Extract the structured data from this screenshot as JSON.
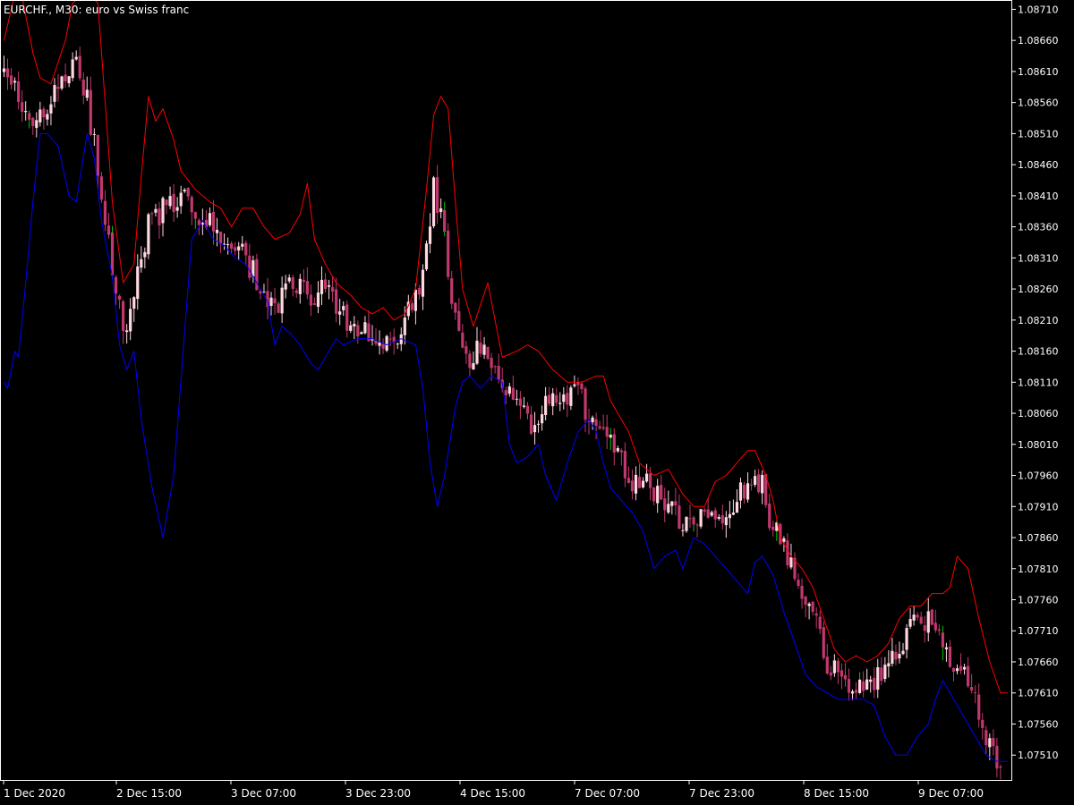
{
  "header": {
    "title": "EURCHF., M30:  euro vs Swiss franc"
  },
  "colors": {
    "background": "#000000",
    "frame": "#ffffff",
    "text": "#ffffff",
    "upper_band": "#ff0000",
    "lower_band": "#0000ff",
    "bear_candle": "#c2386e",
    "bull_candle": "#ffd8e0",
    "green_wick": "#00c800"
  },
  "chart_data": {
    "type": "candlestick",
    "title": "EURCHF., M30:  euro vs Swiss franc",
    "ylim": [
      1.0747,
      1.08725
    ],
    "y_ticks": [
      "1.08710",
      "1.08660",
      "1.08610",
      "1.08560",
      "1.08510",
      "1.08460",
      "1.08410",
      "1.08360",
      "1.08310",
      "1.08260",
      "1.08210",
      "1.08160",
      "1.08110",
      "1.08060",
      "1.08010",
      "1.07960",
      "1.07910",
      "1.07860",
      "1.07810",
      "1.07760",
      "1.07710",
      "1.07660",
      "1.07610",
      "1.07560",
      "1.07510"
    ],
    "x_ticks": [
      "1 Dec 2020",
      "2 Dec 15:00",
      "3 Dec 07:00",
      "3 Dec 23:00",
      "4 Dec 15:00",
      "7 Dec 07:00",
      "7 Dec 23:00",
      "8 Dec 15:00",
      "9 Dec 07:00"
    ],
    "close_anchors": [
      [
        0,
        1.0861
      ],
      [
        5,
        1.08555
      ],
      [
        10,
        1.0853
      ],
      [
        16,
        1.08595
      ],
      [
        20,
        1.0865
      ],
      [
        23,
        1.0856
      ],
      [
        27,
        1.0842
      ],
      [
        30,
        1.0828
      ],
      [
        34,
        1.0818
      ],
      [
        37,
        1.0829
      ],
      [
        40,
        1.0836
      ],
      [
        45,
        1.0839
      ],
      [
        50,
        1.084
      ],
      [
        54,
        1.0837
      ],
      [
        58,
        1.0836
      ],
      [
        62,
        1.0832
      ],
      [
        67,
        1.0831
      ],
      [
        72,
        1.0826
      ],
      [
        76,
        1.0823
      ],
      [
        80,
        1.0828
      ],
      [
        84,
        1.0824
      ],
      [
        88,
        1.0826
      ],
      [
        92,
        1.0823
      ],
      [
        96,
        1.082
      ],
      [
        100,
        1.0819
      ],
      [
        105,
        1.08185
      ],
      [
        110,
        1.08195
      ],
      [
        114,
        1.0824
      ],
      [
        117,
        1.0832
      ],
      [
        119,
        1.0842
      ],
      [
        121,
        1.0838
      ],
      [
        123,
        1.0828
      ],
      [
        126,
        1.0818
      ],
      [
        128,
        1.0814
      ],
      [
        132,
        1.0816
      ],
      [
        135,
        1.0813
      ],
      [
        138,
        1.0811
      ],
      [
        142,
        1.0808
      ],
      [
        146,
        1.0804
      ],
      [
        150,
        1.0809
      ],
      [
        154,
        1.08095
      ],
      [
        158,
        1.0809
      ],
      [
        161,
        1.0807
      ],
      [
        164,
        1.0806
      ],
      [
        167,
        1.0804
      ],
      [
        170,
        1.08
      ],
      [
        174,
        1.0794
      ],
      [
        178,
        1.0796
      ],
      [
        182,
        1.0792
      ],
      [
        186,
        1.0789
      ],
      [
        190,
        1.0787
      ],
      [
        194,
        1.0789
      ],
      [
        198,
        1.0788
      ],
      [
        201,
        1.079
      ],
      [
        204,
        1.0794
      ],
      [
        208,
        1.0796
      ],
      [
        210,
        1.0794
      ],
      [
        213,
        1.0787
      ],
      [
        216,
        1.0785
      ],
      [
        219,
        1.0779
      ],
      [
        222,
        1.0776
      ],
      [
        225,
        1.0772
      ],
      [
        228,
        1.0766
      ],
      [
        231,
        1.0764
      ],
      [
        234,
        1.0763
      ],
      [
        238,
        1.0762
      ],
      [
        242,
        1.0764
      ],
      [
        246,
        1.0767
      ],
      [
        250,
        1.077
      ],
      [
        254,
        1.0773
      ],
      [
        258,
        1.0772
      ],
      [
        261,
        1.0768
      ],
      [
        264,
        1.0766
      ],
      [
        267,
        1.0762
      ],
      [
        270,
        1.0758
      ],
      [
        273,
        1.0753
      ],
      [
        276,
        1.0749
      ]
    ],
    "series": [
      {
        "name": "",
        "color": "#ff0000",
        "points": [
          [
            0,
            1.0866
          ],
          [
            2,
            1.0871
          ],
          [
            4,
            1.0876
          ],
          [
            6,
            1.087
          ],
          [
            8,
            1.0864
          ],
          [
            10,
            1.086
          ],
          [
            13,
            1.0859
          ],
          [
            17,
            1.0866
          ],
          [
            19,
            1.0872
          ],
          [
            21,
            1.0873
          ],
          [
            23,
            1.0874
          ],
          [
            26,
            1.0872
          ],
          [
            28,
            1.0856
          ],
          [
            30,
            1.084
          ],
          [
            33,
            1.0827
          ],
          [
            36,
            1.083
          ],
          [
            38,
            1.0844
          ],
          [
            40,
            1.0857
          ],
          [
            42,
            1.0853
          ],
          [
            44,
            1.0855
          ],
          [
            47,
            1.085
          ],
          [
            49,
            1.0845
          ],
          [
            53,
            1.0842
          ],
          [
            57,
            1.084
          ],
          [
            60,
            1.0839
          ],
          [
            63,
            1.0836
          ],
          [
            66,
            1.0839
          ],
          [
            69,
            1.0839
          ],
          [
            72,
            1.0836
          ],
          [
            75,
            1.0834
          ],
          [
            79,
            1.0835
          ],
          [
            82,
            1.0838
          ],
          [
            84,
            1.0843
          ],
          [
            86,
            1.0834
          ],
          [
            89,
            1.083
          ],
          [
            92,
            1.0827
          ],
          [
            96,
            1.0825
          ],
          [
            99,
            1.0823
          ],
          [
            102,
            1.0822
          ],
          [
            105,
            1.0823
          ],
          [
            108,
            1.0821
          ],
          [
            111,
            1.0822
          ],
          [
            114,
            1.0826
          ],
          [
            117,
            1.0842
          ],
          [
            119,
            1.0854
          ],
          [
            121,
            1.0857
          ],
          [
            123,
            1.0855
          ],
          [
            125,
            1.084
          ],
          [
            127,
            1.0826
          ],
          [
            130,
            1.082
          ],
          [
            134,
            1.0827
          ],
          [
            136,
            1.0821
          ],
          [
            138,
            1.0815
          ],
          [
            142,
            1.0816
          ],
          [
            145,
            1.0817
          ],
          [
            148,
            1.0816
          ],
          [
            152,
            1.0813
          ],
          [
            156,
            1.0811
          ],
          [
            160,
            1.0811
          ],
          [
            164,
            1.0812
          ],
          [
            166,
            1.0812
          ],
          [
            168,
            1.0808
          ],
          [
            170,
            1.0806
          ],
          [
            173,
            1.0803
          ],
          [
            176,
            1.0798
          ],
          [
            180,
            1.0796
          ],
          [
            184,
            1.0797
          ],
          [
            188,
            1.0793
          ],
          [
            191,
            1.0791
          ],
          [
            194,
            1.0791
          ],
          [
            197,
            1.0795
          ],
          [
            200,
            1.0796
          ],
          [
            203,
            1.0798
          ],
          [
            206,
            1.08
          ],
          [
            208,
            1.08
          ],
          [
            211,
            1.0796
          ],
          [
            213,
            1.0792
          ],
          [
            215,
            1.0786
          ],
          [
            218,
            1.0783
          ],
          [
            221,
            1.0781
          ],
          [
            224,
            1.0778
          ],
          [
            227,
            1.0773
          ],
          [
            230,
            1.0768
          ],
          [
            233,
            1.0766
          ],
          [
            236,
            1.0767
          ],
          [
            239,
            1.0766
          ],
          [
            242,
            1.0767
          ],
          [
            245,
            1.0769
          ],
          [
            248,
            1.0773
          ],
          [
            251,
            1.0775
          ],
          [
            254,
            1.0775
          ],
          [
            257,
            1.0777
          ],
          [
            260,
            1.0777
          ],
          [
            262,
            1.0778
          ],
          [
            264,
            1.0783
          ],
          [
            267,
            1.0781
          ],
          [
            270,
            1.0773
          ],
          [
            273,
            1.0766
          ],
          [
            276,
            1.0761
          ],
          [
            278,
            1.0761
          ]
        ]
      },
      {
        "name": "",
        "color": "#0000ff",
        "points": [
          [
            0,
            1.0811
          ],
          [
            1,
            1.081
          ],
          [
            3,
            1.0816
          ],
          [
            4,
            1.0815
          ],
          [
            6,
            1.0827
          ],
          [
            8,
            1.084
          ],
          [
            10,
            1.0851
          ],
          [
            12,
            1.0851
          ],
          [
            15,
            1.0849
          ],
          [
            18,
            1.0841
          ],
          [
            20,
            1.084
          ],
          [
            23,
            1.0851
          ],
          [
            25,
            1.0847
          ],
          [
            27,
            1.0837
          ],
          [
            30,
            1.0828
          ],
          [
            32,
            1.0817
          ],
          [
            34,
            1.0813
          ],
          [
            36,
            1.0816
          ],
          [
            38,
            1.0805
          ],
          [
            41,
            1.0794
          ],
          [
            44,
            1.0786
          ],
          [
            47,
            1.0796
          ],
          [
            50,
            1.0819
          ],
          [
            52,
            1.0834
          ],
          [
            55,
            1.0837
          ],
          [
            58,
            1.0834
          ],
          [
            61,
            1.0833
          ],
          [
            64,
            1.0831
          ],
          [
            67,
            1.083
          ],
          [
            70,
            1.0827
          ],
          [
            73,
            1.0824
          ],
          [
            75,
            1.0817
          ],
          [
            77,
            1.082
          ],
          [
            79,
            1.0819
          ],
          [
            82,
            1.0817
          ],
          [
            85,
            1.0814
          ],
          [
            87,
            1.0813
          ],
          [
            89,
            1.0815
          ],
          [
            92,
            1.0818
          ],
          [
            94,
            1.0817
          ],
          [
            98,
            1.0818
          ],
          [
            102,
            1.0818
          ],
          [
            106,
            1.0817
          ],
          [
            110,
            1.0818
          ],
          [
            114,
            1.0817
          ],
          [
            116,
            1.081
          ],
          [
            118,
            1.0798
          ],
          [
            120,
            1.0791
          ],
          [
            122,
            1.0796
          ],
          [
            125,
            1.0807
          ],
          [
            127,
            1.0811
          ],
          [
            129,
            1.0812
          ],
          [
            132,
            1.081
          ],
          [
            135,
            1.0812
          ],
          [
            138,
            1.0811
          ],
          [
            140,
            1.0801
          ],
          [
            142,
            1.0798
          ],
          [
            145,
            1.0799
          ],
          [
            148,
            1.0801
          ],
          [
            150,
            1.0796
          ],
          [
            153,
            1.0792
          ],
          [
            156,
            1.0798
          ],
          [
            159,
            1.0803
          ],
          [
            162,
            1.0805
          ],
          [
            164,
            1.0803
          ],
          [
            166,
            1.0798
          ],
          [
            168,
            1.0794
          ],
          [
            171,
            1.0792
          ],
          [
            174,
            1.079
          ],
          [
            177,
            1.0787
          ],
          [
            180,
            1.0781
          ],
          [
            183,
            1.0783
          ],
          [
            186,
            1.0784
          ],
          [
            188,
            1.0781
          ],
          [
            191,
            1.0786
          ],
          [
            194,
            1.0785
          ],
          [
            197,
            1.0783
          ],
          [
            200,
            1.0781
          ],
          [
            203,
            1.0779
          ],
          [
            206,
            1.0777
          ],
          [
            208,
            1.0782
          ],
          [
            210,
            1.0783
          ],
          [
            213,
            1.078
          ],
          [
            216,
            1.0774
          ],
          [
            219,
            1.0769
          ],
          [
            222,
            1.0764
          ],
          [
            225,
            1.0762
          ],
          [
            228,
            1.0761
          ],
          [
            231,
            1.076
          ],
          [
            234,
            1.076
          ],
          [
            238,
            1.076
          ],
          [
            241,
            1.0759
          ],
          [
            244,
            1.0754
          ],
          [
            247,
            1.0751
          ],
          [
            250,
            1.0751
          ],
          [
            253,
            1.0754
          ],
          [
            256,
            1.0756
          ],
          [
            258,
            1.076
          ],
          [
            260,
            1.0763
          ],
          [
            263,
            1.076
          ],
          [
            266,
            1.0757
          ],
          [
            269,
            1.0754
          ],
          [
            272,
            1.0751
          ],
          [
            275,
            1.075
          ],
          [
            278,
            1.075
          ]
        ]
      }
    ]
  }
}
